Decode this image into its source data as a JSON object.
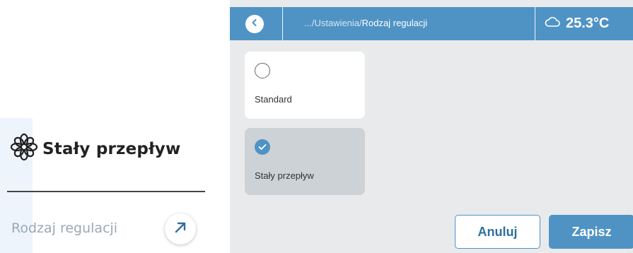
{
  "zoom": {
    "title": "Stały przepływ",
    "label": "Rodzaj regulacji",
    "icon": "flower-icon",
    "action_icon": "arrow-up-right-icon"
  },
  "header": {
    "breadcrumb_prefix": ".../Ustawienia/",
    "breadcrumb_current": "Rodzaj regulacji",
    "temperature": "25.3°C",
    "weather_icon": "cloud-icon",
    "back_icon": "chevron-left-icon"
  },
  "options": [
    {
      "label": "Standard",
      "selected": false
    },
    {
      "label": "Stały przepływ",
      "selected": true
    }
  ],
  "buttons": {
    "cancel": "Anuluj",
    "save": "Zapisz"
  },
  "colors": {
    "accent": "#4f93c5",
    "screen_bg": "#e9eaec",
    "selected_card": "#cdd2d6"
  }
}
